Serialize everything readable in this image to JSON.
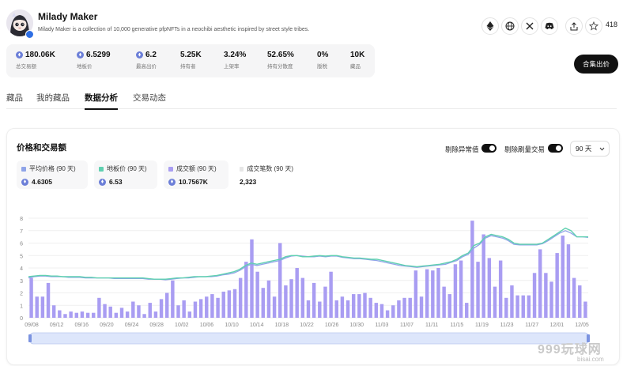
{
  "collection": {
    "name": "Milady Maker",
    "description": "Milady Maker is a collection of 10,000 generative pfpNFTs in a neochibi aesthetic inspired by street style tribes.",
    "like_count": "418"
  },
  "header_icons": [
    "ethereum-icon",
    "globe-icon",
    "x-icon",
    "discord-icon",
    "share-icon",
    "star-icon"
  ],
  "stats": [
    {
      "value": "180.06K",
      "label": "总交易额",
      "eth": true
    },
    {
      "value": "6.5299",
      "label": "地板价",
      "eth": true
    },
    {
      "value": "6.2",
      "label": "最高出价",
      "eth": true
    },
    {
      "value": "5.25K",
      "label": "持有者",
      "eth": false
    },
    {
      "value": "3.24%",
      "label": "上架率",
      "eth": false
    },
    {
      "value": "52.65%",
      "label": "持有分散度",
      "eth": false
    },
    {
      "value": "0%",
      "label": "版税",
      "eth": false
    },
    {
      "value": "10K",
      "label": "藏品",
      "eth": false
    }
  ],
  "offer_button": "合集出价",
  "tabs": [
    "藏品",
    "我的藏品",
    "数据分析",
    "交易动态"
  ],
  "active_tab": 2,
  "card": {
    "title": "价格和交易额",
    "toggle1": "剔除异常值",
    "toggle2": "剔除刷量交易",
    "period": "90 天"
  },
  "legend": [
    {
      "label": "平均价格 (90 天)",
      "value": "4.6305",
      "color": "#8fa4e8",
      "eth": true
    },
    {
      "label": "地板价 (90 天)",
      "value": "6.53",
      "color": "#5fd0b0",
      "eth": true
    },
    {
      "label": "成交额 (90 天)",
      "value": "10.7567K",
      "color": "#a99df2",
      "eth": true
    },
    {
      "label": "成交笔数 (90 天)",
      "value": "2,323",
      "color": "#e6e6e6",
      "eth": false
    }
  ],
  "colors": {
    "bar": "#a99df2",
    "floor": "#5fd0b0",
    "avg": "#8fa4e8"
  },
  "watermark": {
    "text": "999玩球网",
    "sub": "bisai.com"
  },
  "chart_data": {
    "type": "bar",
    "yticks": [
      "8",
      "7",
      "6",
      "5",
      "4",
      "3",
      "2",
      "1",
      "0"
    ],
    "ylim": [
      0,
      8
    ],
    "xticks": [
      "09/08",
      "09/12",
      "09/16",
      "09/20",
      "09/24",
      "09/28",
      "10/02",
      "10/06",
      "10/10",
      "10/14",
      "10/18",
      "10/22",
      "10/26",
      "10/30",
      "11/03",
      "11/07",
      "11/11",
      "11/15",
      "11/19",
      "11/23",
      "11/27",
      "12/01",
      "12/05"
    ],
    "bars": [
      3.2,
      1.7,
      1.7,
      2.8,
      1.0,
      0.6,
      0.3,
      0.5,
      0.4,
      0.5,
      0.4,
      0.4,
      1.6,
      1.1,
      0.9,
      0.4,
      0.8,
      0.5,
      1.3,
      1.0,
      0.3,
      1.2,
      0.5,
      1.5,
      2.0,
      3.0,
      1.0,
      1.4,
      0.5,
      1.3,
      1.5,
      1.7,
      1.9,
      1.6,
      2.1,
      2.2,
      2.3,
      3.2,
      4.5,
      6.3,
      3.7,
      2.4,
      3.0,
      1.7,
      6.0,
      2.6,
      3.1,
      4.0,
      3.2,
      1.4,
      2.8,
      1.3,
      2.5,
      3.7,
      1.4,
      1.7,
      1.4,
      1.9,
      1.9,
      2.0,
      1.6,
      1.2,
      1.1,
      0.6,
      1.0,
      1.4,
      1.6,
      1.6,
      3.8,
      1.7,
      3.9,
      3.8,
      4.0,
      2.5,
      1.9,
      4.3,
      4.6,
      1.2,
      7.8,
      4.5,
      6.7,
      4.8,
      2.5,
      4.6,
      1.6,
      2.6,
      1.8,
      1.8,
      1.8,
      3.6,
      5.5,
      3.6,
      2.9,
      5.2,
      6.6,
      5.9,
      3.2,
      2.6,
      1.3
    ],
    "floor": [
      3.3,
      3.35,
      3.4,
      3.4,
      3.35,
      3.35,
      3.3,
      3.3,
      3.3,
      3.3,
      3.25,
      3.25,
      3.2,
      3.2,
      3.2,
      3.2,
      3.2,
      3.2,
      3.2,
      3.2,
      3.2,
      3.15,
      3.1,
      3.1,
      3.1,
      3.15,
      3.2,
      3.2,
      3.25,
      3.3,
      3.3,
      3.3,
      3.35,
      3.4,
      3.5,
      3.6,
      3.7,
      3.9,
      4.2,
      4.4,
      4.3,
      4.4,
      4.5,
      4.6,
      4.7,
      4.9,
      5.0,
      5.0,
      4.9,
      4.9,
      4.95,
      5.0,
      4.95,
      5.0,
      5.0,
      4.9,
      4.85,
      4.8,
      4.8,
      4.75,
      4.7,
      4.7,
      4.6,
      4.5,
      4.4,
      4.3,
      4.2,
      4.15,
      4.1,
      4.15,
      4.2,
      4.25,
      4.3,
      4.4,
      4.5,
      4.7,
      5.0,
      5.2,
      5.8,
      6.0,
      6.5,
      6.7,
      6.6,
      6.5,
      6.3,
      6.0,
      5.9,
      5.9,
      5.9,
      5.9,
      6.0,
      6.3,
      6.6,
      6.9,
      7.2,
      7.0,
      6.5,
      6.5,
      6.5
    ],
    "avg": [
      3.2,
      3.3,
      3.35,
      3.35,
      3.3,
      3.3,
      3.3,
      3.25,
      3.25,
      3.25,
      3.2,
      3.2,
      3.2,
      3.2,
      3.2,
      3.15,
      3.15,
      3.15,
      3.15,
      3.15,
      3.15,
      3.1,
      3.1,
      3.1,
      3.05,
      3.1,
      3.15,
      3.2,
      3.2,
      3.25,
      3.3,
      3.3,
      3.3,
      3.35,
      3.45,
      3.5,
      3.6,
      3.8,
      4.1,
      4.3,
      4.2,
      4.3,
      4.4,
      4.5,
      4.6,
      4.8,
      4.95,
      5.0,
      4.95,
      4.9,
      4.9,
      4.95,
      4.9,
      4.95,
      4.95,
      4.85,
      4.8,
      4.75,
      4.75,
      4.7,
      4.65,
      4.6,
      4.5,
      4.4,
      4.3,
      4.2,
      4.15,
      4.1,
      4.05,
      4.1,
      4.15,
      4.2,
      4.25,
      4.3,
      4.45,
      4.6,
      4.9,
      5.1,
      5.6,
      5.9,
      6.4,
      6.6,
      6.5,
      6.4,
      6.2,
      5.9,
      5.85,
      5.85,
      5.85,
      5.85,
      5.95,
      6.2,
      6.5,
      6.8,
      7.0,
      6.8,
      6.5,
      6.5,
      6.45
    ]
  }
}
